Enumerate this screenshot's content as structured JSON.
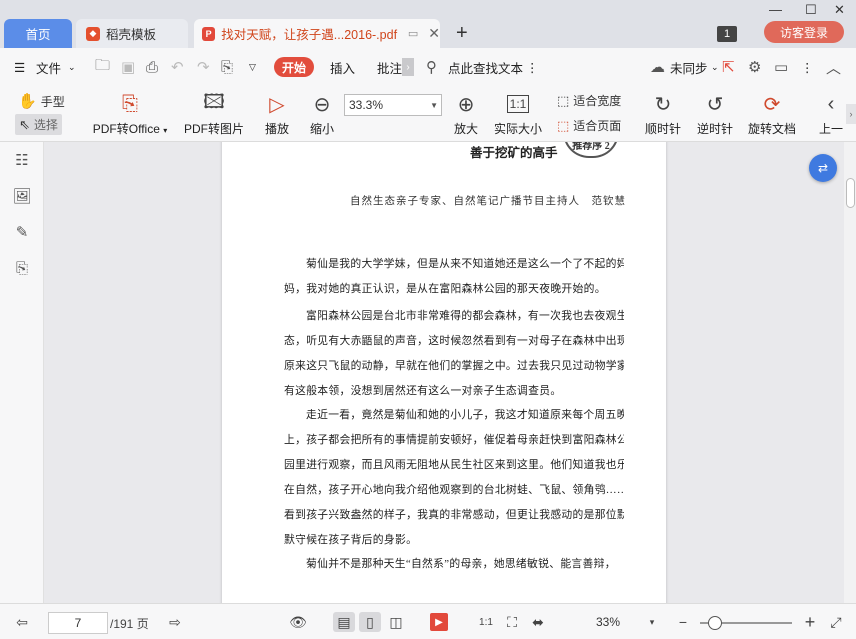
{
  "tabs": {
    "home": "首页",
    "daoke": "稻壳模板",
    "pdf": "找对天赋，让孩子遇...2016-.pdf",
    "badge": "1",
    "login": "访客登录"
  },
  "menu": {
    "file": "文件",
    "start": "开始",
    "insert": "插入",
    "annotate": "批注",
    "search": "点此查找文本",
    "sync": "未同步"
  },
  "ribbon": {
    "hand": "手型",
    "select": "选择",
    "pdf_to_office": "PDF转Office",
    "pdf_to_image": "PDF转图片",
    "play": "播放",
    "zoom_out": "缩小",
    "zoom_value": "33.3%",
    "zoom_in": "放大",
    "actual_size": "实际大小",
    "fit_width": "适合宽度",
    "fit_page": "适合页面",
    "rotate_cw": "顺时针",
    "rotate_ccw": "逆时针",
    "rotate_doc": "旋转文档",
    "prev": "上一"
  },
  "document": {
    "header": "善于挖矿的高手",
    "badge": "推荐序 2",
    "subtitle": "自然生态亲子专家、自然笔记广播节目主持人　范钦慧",
    "paragraphs": [
      {
        "lines": [
          "菊仙是我的大学学妹，但是从来不知道她还是这么一个了不起的妈",
          "妈，我对她的真正认识，是从在富阳森林公园的那天夜晚开始的。"
        ]
      },
      {
        "lines": [
          "富阳森林公园是台北市非常难得的都会森林，有一次我也去夜观生",
          "态，听见有大赤鼯鼠的声音，这时候忽然看到有一对母子在森林中出现，",
          "原来这只飞鼠的动静，早就在他们的掌握之中。过去我只见过动物学家",
          "有这般本领，没想到居然还有这么一对亲子生态调查员。"
        ]
      },
      {
        "lines": [
          "走近一看，竟然是菊仙和她的小儿子，我这才知道原来每个周五晚",
          "上，孩子都会把所有的事情提前安顿好，催促着母亲赶快到富阳森林公",
          "园里进行观察，而且风雨无阻地从民生社区来到这里。他们知道我也乐",
          "在自然，孩子开心地向我介绍他观察到的台北树蛙、飞鼠、领角鸮……",
          "看到孩子兴致盎然的样子，我真的非常感动，但更让我感动的是那位默",
          "默守候在孩子背后的身影。"
        ]
      },
      {
        "lines": [
          "菊仙并不是那种天生“自然系”的母亲，她思绪敏锐、能言善辩，"
        ]
      }
    ]
  },
  "status": {
    "current_page": "7",
    "total_pages": "/191 页",
    "zoom": "33%"
  }
}
